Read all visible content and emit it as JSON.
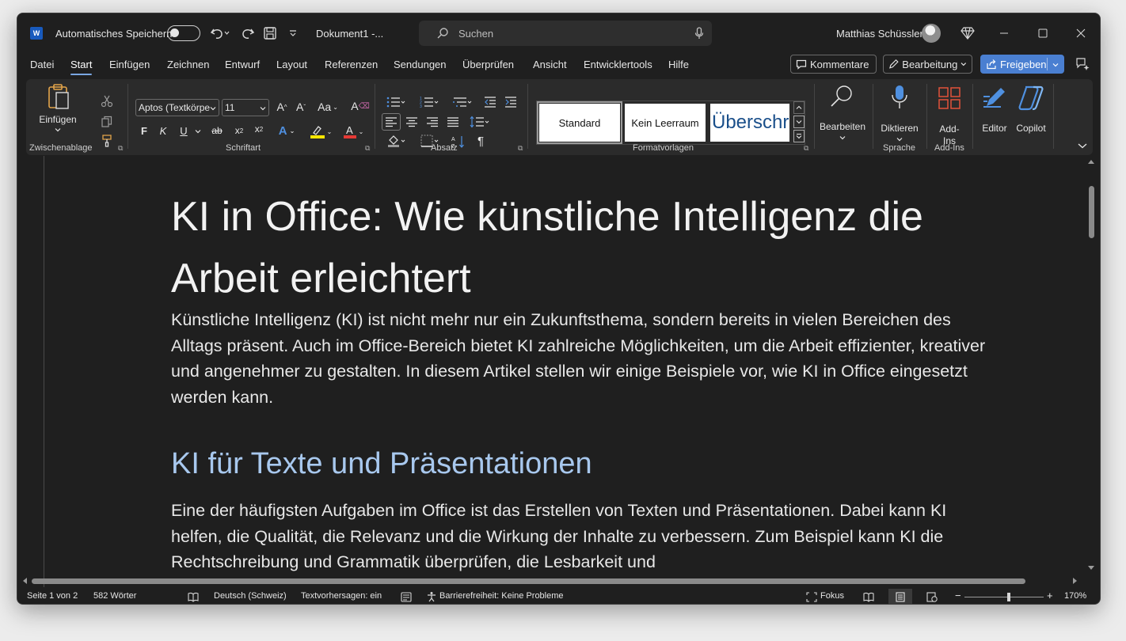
{
  "titlebar": {
    "autosave_label": "Automatisches Speichern",
    "doc_name": "Dokument1  -...",
    "search_placeholder": "Suchen",
    "user_name": "Matthias Schüssler"
  },
  "menu": {
    "tabs": [
      "Datei",
      "Start",
      "Einfügen",
      "Zeichnen",
      "Entwurf",
      "Layout",
      "Referenzen",
      "Sendungen",
      "Überprüfen",
      "Ansicht",
      "Entwicklertools",
      "Hilfe"
    ],
    "active_tab": "Start",
    "comments_label": "Kommentare",
    "editing_label": "Bearbeitung",
    "share_label": "Freigeben"
  },
  "ribbon": {
    "paste_label": "Einfügen",
    "clipboard_group": "Zwischenablage",
    "font_name": "Aptos (Textkörpe",
    "font_size": "11",
    "font_group": "Schriftart",
    "bold_label": "F",
    "italic_label": "K",
    "underline_label": "U",
    "strike_label": "ab",
    "paragraph_group": "Absatz",
    "styles": [
      "Standard",
      "Kein Leerraum",
      "Überschrift"
    ],
    "styles_group": "Formatvorlagen",
    "find_label": "Bearbeiten",
    "dictate_label": "Diktieren",
    "voice_group": "Sprache",
    "addins_label": "Add-Ins",
    "addins_group": "Add-Ins",
    "editor_label": "Editor",
    "copilot_label": "Copilot"
  },
  "document": {
    "title": "KI in Office: Wie künstliche Intelligenz die Arbeit erleichtert",
    "para1": "Künstliche Intelligenz (KI) ist nicht mehr nur ein Zukunftsthema, sondern bereits in vielen Bereichen des Alltags präsent. Auch im Office-Bereich bietet KI zahlreiche Möglichkeiten, um die Arbeit effizienter, kreativer und angenehmer zu gestalten. In diesem Artikel stellen wir einige Beispiele vor, wie KI in Office eingesetzt werden kann.",
    "heading2": "KI für Texte und Präsentationen",
    "para2": "Eine der häufigsten Aufgaben im Office ist das Erstellen von Texten und Präsentationen. Dabei kann KI helfen, die Qualität, die Relevanz und die Wirkung der Inhalte zu verbessern. Zum Beispiel kann KI die Rechtschreibung und Grammatik überprüfen, die Lesbarkeit und"
  },
  "status": {
    "page": "Seite 1 von 2",
    "words": "582 Wörter",
    "language": "Deutsch (Schweiz)",
    "predictions": "Textvorhersagen: ein",
    "accessibility": "Barrierefreiheit: Keine Probleme",
    "focus": "Fokus",
    "zoom": "170%"
  }
}
